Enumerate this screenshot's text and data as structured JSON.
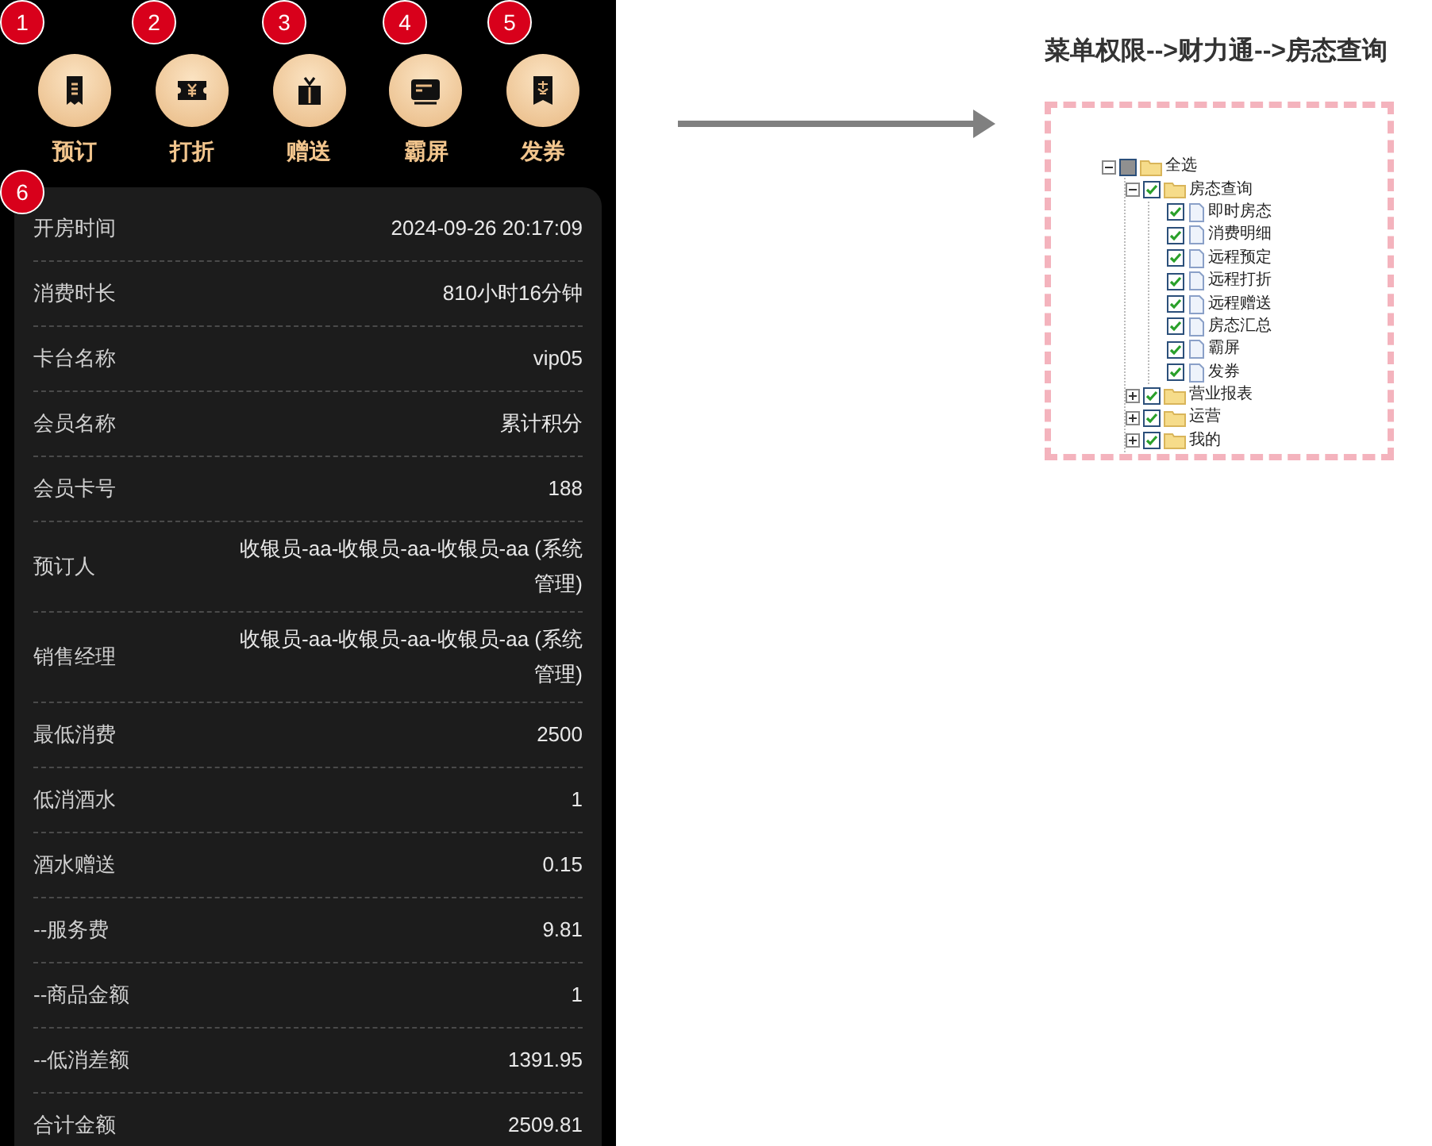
{
  "actions": [
    {
      "label": "预订",
      "badge": "1"
    },
    {
      "label": "打折",
      "badge": "2"
    },
    {
      "label": "赠送",
      "badge": "3"
    },
    {
      "label": "霸屏",
      "badge": "4"
    },
    {
      "label": "发券",
      "badge": "5"
    }
  ],
  "details_badge": "6",
  "details": [
    {
      "label": "开房时间",
      "value": "2024-09-26 20:17:09"
    },
    {
      "label": "消费时长",
      "value": "810小时16分钟"
    },
    {
      "label": "卡台名称",
      "value": "vip05"
    },
    {
      "label": "会员名称",
      "value": "累计积分"
    },
    {
      "label": "会员卡号",
      "value": "188"
    },
    {
      "label": "预订人",
      "value": "收银员-aa-收银员-aa-收银员-aa (系统管理)"
    },
    {
      "label": "销售经理",
      "value": "收银员-aa-收银员-aa-收银员-aa (系统管理)"
    },
    {
      "label": "最低消费",
      "value": "2500"
    },
    {
      "label": "低消酒水",
      "value": "1"
    },
    {
      "label": "酒水赠送",
      "value": "0.15"
    },
    {
      "label": "--服务费",
      "value": "9.81"
    },
    {
      "label": "--商品金额",
      "value": "1"
    },
    {
      "label": "--低消差额",
      "value": "1391.95"
    },
    {
      "label": "合计金额",
      "value": "2509.81"
    }
  ],
  "permission_title": "菜单权限-->财力通-->房态查询",
  "tree": [
    {
      "label": "全选",
      "kind": "folder",
      "checked": false,
      "indeterminate": true,
      "expanded": true,
      "children": [
        {
          "label": "房态查询",
          "kind": "folder",
          "checked": true,
          "indeterminate": false,
          "expanded": true,
          "children": [
            {
              "label": "即时房态",
              "kind": "page",
              "checked": true,
              "indeterminate": false
            },
            {
              "label": "消费明细",
              "kind": "page",
              "checked": true,
              "indeterminate": false
            },
            {
              "label": "远程预定",
              "kind": "page",
              "checked": true,
              "indeterminate": false
            },
            {
              "label": "远程打折",
              "kind": "page",
              "checked": true,
              "indeterminate": false
            },
            {
              "label": "远程赠送",
              "kind": "page",
              "checked": true,
              "indeterminate": false
            },
            {
              "label": "房态汇总",
              "kind": "page",
              "checked": true,
              "indeterminate": false
            },
            {
              "label": "霸屏",
              "kind": "page",
              "checked": true,
              "indeterminate": false
            },
            {
              "label": "发券",
              "kind": "page",
              "checked": true,
              "indeterminate": false
            }
          ]
        },
        {
          "label": "营业报表",
          "kind": "folder",
          "checked": true,
          "indeterminate": false,
          "expanded": false
        },
        {
          "label": "运营",
          "kind": "folder",
          "checked": true,
          "indeterminate": false,
          "expanded": false
        },
        {
          "label": "我的",
          "kind": "folder",
          "checked": true,
          "indeterminate": false,
          "expanded": false
        }
      ]
    }
  ]
}
